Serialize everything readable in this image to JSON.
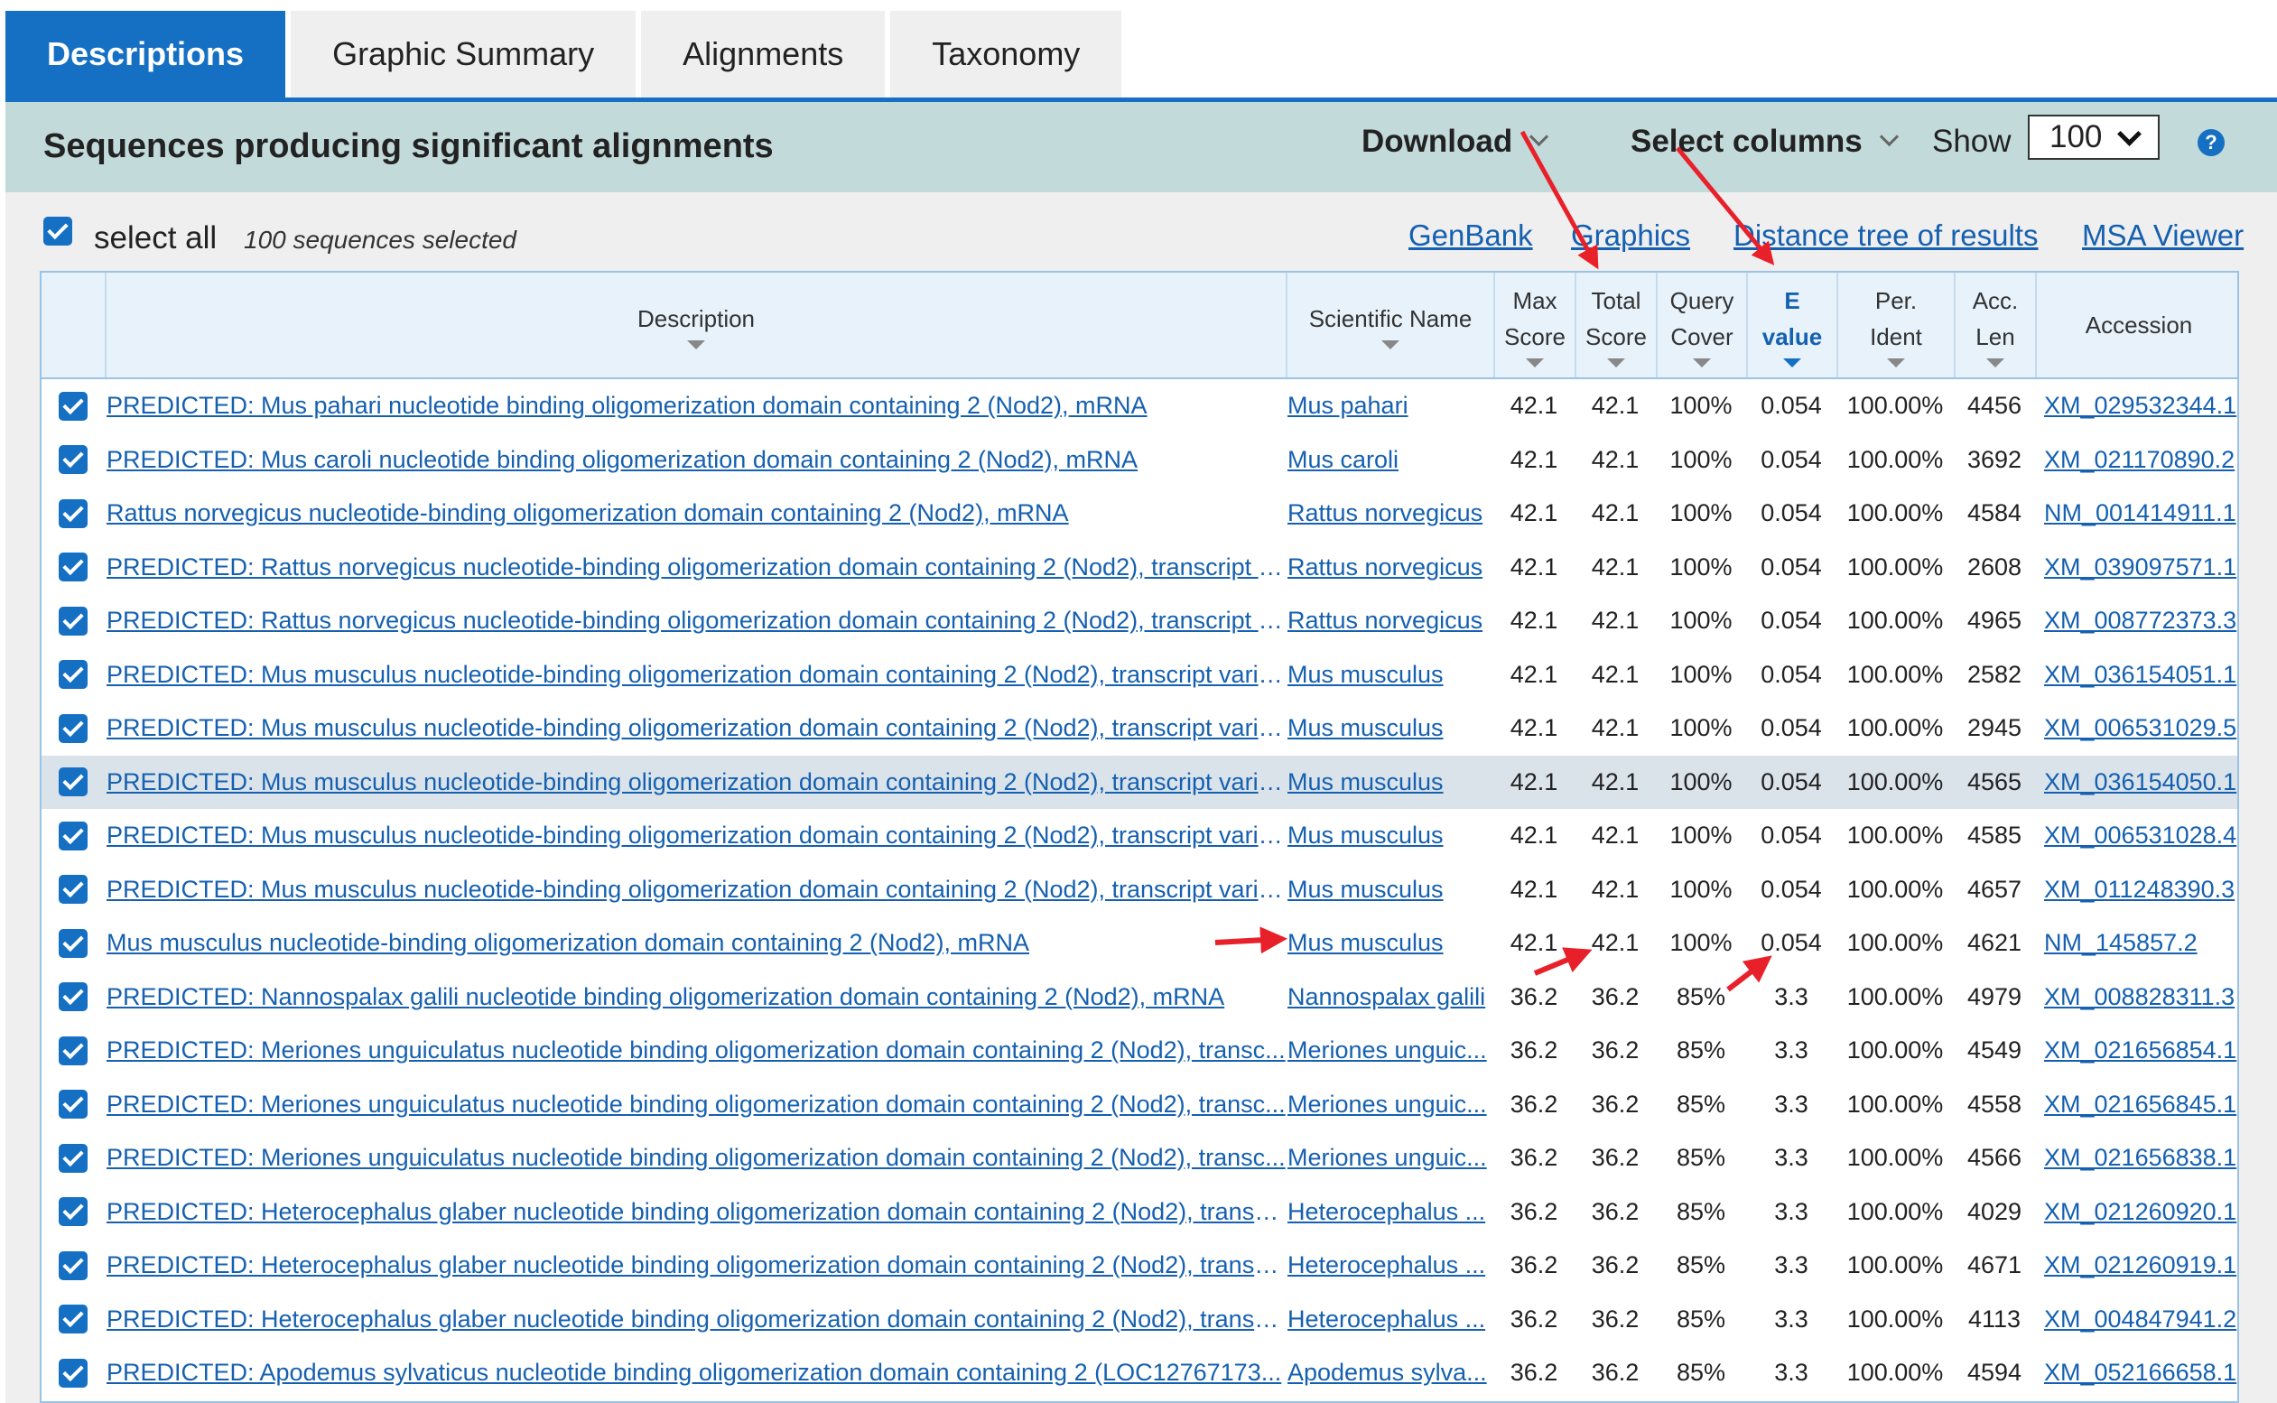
{
  "tabs": [
    {
      "label": "Descriptions",
      "active": true
    },
    {
      "label": "Graphic Summary",
      "active": false
    },
    {
      "label": "Alignments",
      "active": false
    },
    {
      "label": "Taxonomy",
      "active": false
    }
  ],
  "header": {
    "title": "Sequences producing significant alignments",
    "download": "Download",
    "select_columns": "Select columns",
    "show_label": "Show",
    "show_value": "100",
    "help": "?"
  },
  "toolbar": {
    "select_all": "select all",
    "selected_count": "100 sequences selected",
    "links": [
      "GenBank",
      "Graphics",
      "Distance tree of results",
      "MSA Viewer"
    ]
  },
  "columns": [
    {
      "line1": "",
      "line2": ""
    },
    {
      "line1": "Description",
      "line2": ""
    },
    {
      "line1": "Scientific Name",
      "line2": ""
    },
    {
      "line1": "Max",
      "line2": "Score"
    },
    {
      "line1": "Total",
      "line2": "Score"
    },
    {
      "line1": "Query",
      "line2": "Cover"
    },
    {
      "line1": "E",
      "line2": "value"
    },
    {
      "line1": "Per.",
      "line2": "Ident"
    },
    {
      "line1": "Acc.",
      "line2": "Len"
    },
    {
      "line1": "Accession",
      "line2": ""
    }
  ],
  "rows": [
    {
      "desc": "PREDICTED: Mus pahari nucleotide binding oligomerization domain containing 2 (Nod2), mRNA",
      "sci": "Mus pahari",
      "max": "42.1",
      "total": "42.1",
      "cover": "100%",
      "evalue": "0.054",
      "ident": "100.00%",
      "len": "4456",
      "acc": "XM_029532344.1"
    },
    {
      "desc": "PREDICTED: Mus caroli nucleotide binding oligomerization domain containing 2 (Nod2), mRNA",
      "sci": "Mus caroli",
      "max": "42.1",
      "total": "42.1",
      "cover": "100%",
      "evalue": "0.054",
      "ident": "100.00%",
      "len": "3692",
      "acc": "XM_021170890.2"
    },
    {
      "desc": "Rattus norvegicus nucleotide-binding oligomerization domain containing 2 (Nod2), mRNA",
      "sci": "Rattus norvegicus",
      "max": "42.1",
      "total": "42.1",
      "cover": "100%",
      "evalue": "0.054",
      "ident": "100.00%",
      "len": "4584",
      "acc": "NM_001414911.1"
    },
    {
      "desc": "PREDICTED: Rattus norvegicus nucleotide-binding oligomerization domain containing 2 (Nod2), transcript v...",
      "sci": "Rattus norvegicus",
      "max": "42.1",
      "total": "42.1",
      "cover": "100%",
      "evalue": "0.054",
      "ident": "100.00%",
      "len": "2608",
      "acc": "XM_039097571.1"
    },
    {
      "desc": "PREDICTED: Rattus norvegicus nucleotide-binding oligomerization domain containing 2 (Nod2), transcript v...",
      "sci": "Rattus norvegicus",
      "max": "42.1",
      "total": "42.1",
      "cover": "100%",
      "evalue": "0.054",
      "ident": "100.00%",
      "len": "4965",
      "acc": "XM_008772373.3"
    },
    {
      "desc": "PREDICTED: Mus musculus nucleotide-binding oligomerization domain containing 2 (Nod2), transcript varia...",
      "sci": "Mus musculus",
      "max": "42.1",
      "total": "42.1",
      "cover": "100%",
      "evalue": "0.054",
      "ident": "100.00%",
      "len": "2582",
      "acc": "XM_036154051.1"
    },
    {
      "desc": "PREDICTED: Mus musculus nucleotide-binding oligomerization domain containing 2 (Nod2), transcript varia...",
      "sci": "Mus musculus",
      "max": "42.1",
      "total": "42.1",
      "cover": "100%",
      "evalue": "0.054",
      "ident": "100.00%",
      "len": "2945",
      "acc": "XM_006531029.5"
    },
    {
      "desc": "PREDICTED: Mus musculus nucleotide-binding oligomerization domain containing 2 (Nod2), transcript varia...",
      "sci": "Mus musculus",
      "max": "42.1",
      "total": "42.1",
      "cover": "100%",
      "evalue": "0.054",
      "ident": "100.00%",
      "len": "4565",
      "acc": "XM_036154050.1",
      "highlight": true
    },
    {
      "desc": "PREDICTED: Mus musculus nucleotide-binding oligomerization domain containing 2 (Nod2), transcript varia...",
      "sci": "Mus musculus",
      "max": "42.1",
      "total": "42.1",
      "cover": "100%",
      "evalue": "0.054",
      "ident": "100.00%",
      "len": "4585",
      "acc": "XM_006531028.4"
    },
    {
      "desc": "PREDICTED: Mus musculus nucleotide-binding oligomerization domain containing 2 (Nod2), transcript varia...",
      "sci": "Mus musculus",
      "max": "42.1",
      "total": "42.1",
      "cover": "100%",
      "evalue": "0.054",
      "ident": "100.00%",
      "len": "4657",
      "acc": "XM_011248390.3"
    },
    {
      "desc": "Mus musculus nucleotide-binding oligomerization domain containing 2 (Nod2), mRNA",
      "sci": "Mus musculus",
      "max": "42.1",
      "total": "42.1",
      "cover": "100%",
      "evalue": "0.054",
      "ident": "100.00%",
      "len": "4621",
      "acc": "NM_145857.2"
    },
    {
      "desc": "PREDICTED: Nannospalax galili nucleotide binding oligomerization domain containing 2 (Nod2), mRNA",
      "sci": "Nannospalax galili",
      "max": "36.2",
      "total": "36.2",
      "cover": "85%",
      "evalue": "3.3",
      "ident": "100.00%",
      "len": "4979",
      "acc": "XM_008828311.3"
    },
    {
      "desc": "PREDICTED: Meriones unguiculatus nucleotide binding oligomerization domain containing 2 (Nod2), transc...",
      "sci": "Meriones unguic...",
      "max": "36.2",
      "total": "36.2",
      "cover": "85%",
      "evalue": "3.3",
      "ident": "100.00%",
      "len": "4549",
      "acc": "XM_021656854.1"
    },
    {
      "desc": "PREDICTED: Meriones unguiculatus nucleotide binding oligomerization domain containing 2 (Nod2), transc...",
      "sci": "Meriones unguic...",
      "max": "36.2",
      "total": "36.2",
      "cover": "85%",
      "evalue": "3.3",
      "ident": "100.00%",
      "len": "4558",
      "acc": "XM_021656845.1"
    },
    {
      "desc": "PREDICTED: Meriones unguiculatus nucleotide binding oligomerization domain containing 2 (Nod2), transc...",
      "sci": "Meriones unguic...",
      "max": "36.2",
      "total": "36.2",
      "cover": "85%",
      "evalue": "3.3",
      "ident": "100.00%",
      "len": "4566",
      "acc": "XM_021656838.1"
    },
    {
      "desc": "PREDICTED: Heterocephalus glaber nucleotide binding oligomerization domain containing 2 (Nod2), transc...",
      "sci": "Heterocephalus ...",
      "max": "36.2",
      "total": "36.2",
      "cover": "85%",
      "evalue": "3.3",
      "ident": "100.00%",
      "len": "4029",
      "acc": "XM_021260920.1"
    },
    {
      "desc": "PREDICTED: Heterocephalus glaber nucleotide binding oligomerization domain containing 2 (Nod2), transc...",
      "sci": "Heterocephalus ...",
      "max": "36.2",
      "total": "36.2",
      "cover": "85%",
      "evalue": "3.3",
      "ident": "100.00%",
      "len": "4671",
      "acc": "XM_021260919.1"
    },
    {
      "desc": "PREDICTED: Heterocephalus glaber nucleotide binding oligomerization domain containing 2 (Nod2), transc...",
      "sci": "Heterocephalus ...",
      "max": "36.2",
      "total": "36.2",
      "cover": "85%",
      "evalue": "3.3",
      "ident": "100.00%",
      "len": "4113",
      "acc": "XM_004847941.2"
    },
    {
      "desc": "PREDICTED: Apodemus sylvaticus nucleotide binding oligomerization domain containing 2 (LOC12767173...",
      "sci": "Apodemus sylva...",
      "max": "36.2",
      "total": "36.2",
      "cover": "85%",
      "evalue": "3.3",
      "ident": "100.00%",
      "len": "4594",
      "acc": "XM_052166658.1"
    }
  ],
  "colors": {
    "accent": "#1570c4",
    "header_band": "#c2dad9",
    "link": "#1560b0",
    "annotation": "#e8202a"
  }
}
